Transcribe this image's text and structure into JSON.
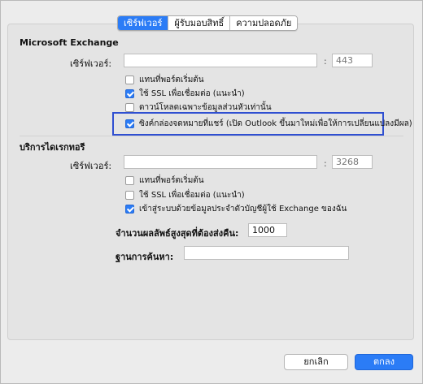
{
  "tabs": [
    {
      "label": "เซิร์ฟเวอร์",
      "active": true
    },
    {
      "label": "ผู้รับมอบสิทธิ์",
      "active": false
    },
    {
      "label": "ความปลอดภัย",
      "active": false
    }
  ],
  "exchange": {
    "title": "Microsoft Exchange",
    "server_label": "เซิร์ฟเวอร์:",
    "server_value": "",
    "port_placeholder": "443",
    "options": [
      {
        "label": "แทนที่พอร์ตเริ่มต้น",
        "checked": false
      },
      {
        "label": "ใช้ SSL เพื่อเชื่อมต่อ (แนะนำ)",
        "checked": true
      },
      {
        "label": "ดาวน์โหลดเฉพาะข้อมูลส่วนหัวเท่านั้น",
        "checked": false
      },
      {
        "label": "ซิงค์กล่องจดหมายที่แชร์ (เปิด Outlook ขึ้นมาใหม่เพื่อให้การเปลี่ยนแปลงมีผล)",
        "checked": true
      }
    ]
  },
  "directory": {
    "title": "บริการไดเรกทอรี",
    "server_label": "เซิร์ฟเวอร์:",
    "server_value": "",
    "port_placeholder": "3268",
    "options": [
      {
        "label": "แทนที่พอร์ตเริ่มต้น",
        "checked": false
      },
      {
        "label": "ใช้ SSL เพื่อเชื่อมต่อ (แนะนำ)",
        "checked": false
      },
      {
        "label": "เข้าสู่ระบบด้วยข้อมูลประจำตัวบัญชีผู้ใช้ Exchange ของฉัน",
        "checked": true
      }
    ],
    "max_results_label": "จำนวนผลลัพธ์สูงสุดที่ต้องส่งคืน:",
    "max_results_value": "1000",
    "search_base_label": "ฐานการค้นหา:",
    "search_base_value": ""
  },
  "buttons": {
    "cancel": "ยกเลิก",
    "ok": "ตกลง"
  },
  "colors": {
    "accent": "#2b7cf6",
    "highlight": "#2f4fd1"
  }
}
